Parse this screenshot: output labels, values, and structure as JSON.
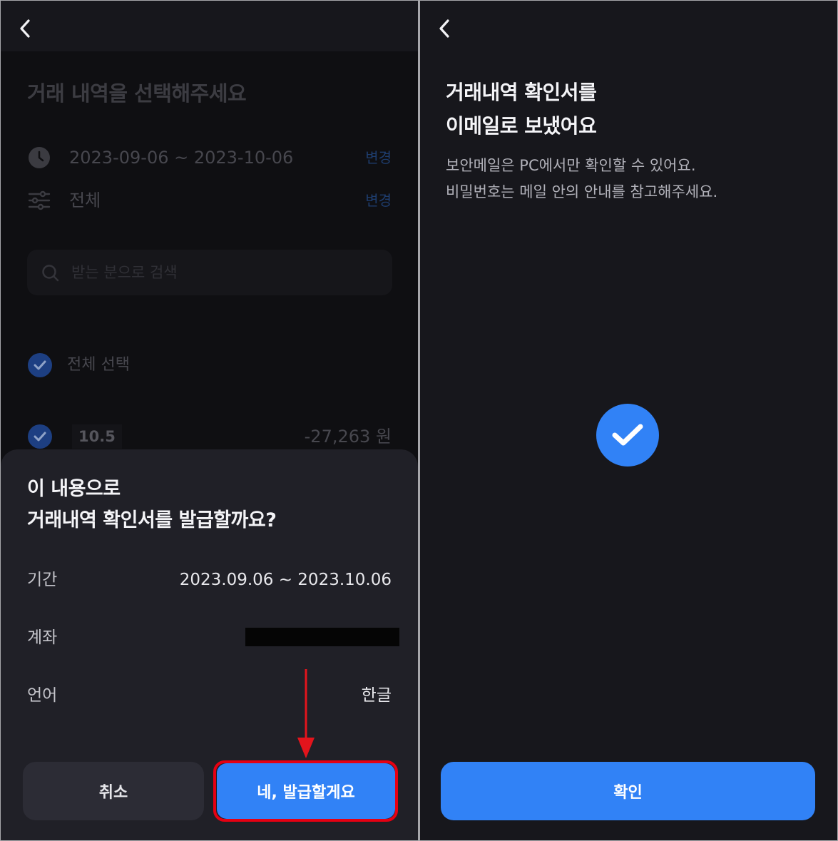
{
  "colors": {
    "toss_blue": "#3182f6",
    "screen_background": "#17171c",
    "dimmed_background": "#0f0f12",
    "sheet_background": "#202027",
    "secondary_button": "#2c2c35",
    "annotation_red": "#e60012"
  },
  "left_screen": {
    "header": {
      "back_icon": "chevron-left-icon"
    },
    "background_page": {
      "title": "거래 내역을 선택해주세요",
      "period": {
        "icon": "clock-icon",
        "value": "2023-09-06 ~ 2023-10-06",
        "change_label": "변경"
      },
      "filter": {
        "icon": "sliders-icon",
        "value": "전체",
        "change_label": "변경"
      },
      "search": {
        "icon": "search-icon",
        "placeholder": "받는 분으로 검색"
      },
      "select_all": {
        "icon": "check-circle-icon",
        "label": "전체 선택"
      },
      "transactions": [
        {
          "date": "10.5",
          "amount": "-27,263 원"
        }
      ]
    },
    "bottom_sheet": {
      "title_lines": [
        "이 내용으로",
        "거래내역 확인서를 발급할까요?"
      ],
      "details": [
        {
          "label": "기간",
          "value": "2023.09.06 ~ 2023.10.06"
        },
        {
          "label": "계좌"
        },
        {
          "label": "언어",
          "value": "한글"
        }
      ],
      "cancel_label": "취소",
      "confirm_label": "네, 발급할게요"
    },
    "annotation": {
      "arrow_icon": "arrow-down-icon"
    }
  },
  "right_screen": {
    "header": {
      "back_icon": "chevron-left-icon"
    },
    "title_lines": [
      "거래내역 확인서를",
      "이메일로 보냈어요"
    ],
    "description_lines": [
      "보안메일은 PC에서만 확인할 수 있어요.",
      "비밀번호는 메일 안의 안내를 참고해주세요."
    ],
    "status_icon": "check-circle-icon",
    "confirm_label": "확인"
  }
}
